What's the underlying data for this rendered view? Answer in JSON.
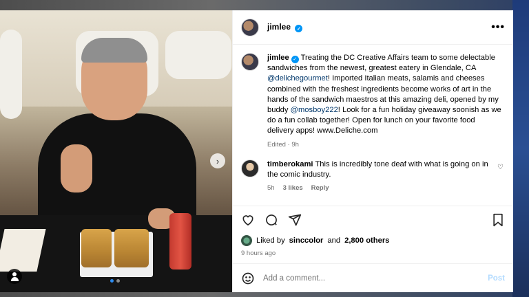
{
  "post": {
    "username": "jimlee",
    "verified_icon": "verified-badge-icon",
    "caption": {
      "p1": "Treating the DC Creative Affairs team to some delectable sandwiches from the newest, greatest eatery in Glendale, CA ",
      "m1": "@delichegourmet",
      "p2": "! Imported Italian meats, salamis and cheeses combined with the freshest ingredients become works of art in the hands of the sandwich maestros at this amazing deli, opened by my buddy ",
      "m2": "@mosboy222",
      "p3": "! Look for a fun holiday giveaway soonish as we do a fun collab together! Open for lunch on your favorite food delivery apps! www.Deliche.com"
    },
    "caption_meta": "Edited · 9h",
    "comments": [
      {
        "username": "timberokami",
        "text": "This is incredibly tone deaf with what is going on in the comic industry.",
        "time": "5h",
        "likes": "3 likes",
        "reply": "Reply"
      }
    ],
    "liked_by_prefix": "Liked by",
    "liked_by_user": "sinccolor",
    "liked_by_and": "and",
    "liked_by_others": "2,800 others",
    "time_ago": "9 hours ago",
    "add_comment_placeholder": "Add a comment...",
    "post_button": "Post",
    "more_label": "•••",
    "next_label": "›"
  },
  "colors": {
    "accent": "#0095f6",
    "mention": "#00376b",
    "muted": "#737373"
  }
}
